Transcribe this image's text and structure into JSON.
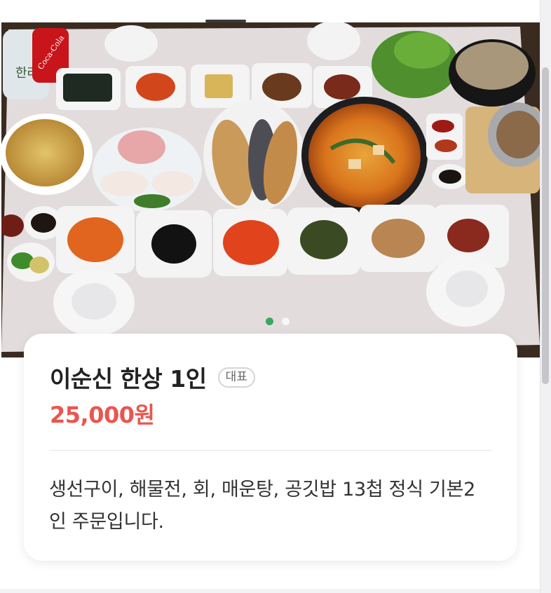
{
  "menu_item": {
    "title": "이순신 한상 1인",
    "badge": "대표",
    "price": "25,000원",
    "description": "생선구이, 해물전, 회, 매운탕, 공깃밥 13첩 정식 기본2인 주문입니다."
  },
  "carousel": {
    "slide_count": 2,
    "active_index": 0
  },
  "photo": {
    "bottle_label": "Coca-Cola",
    "jar_label": "한라산"
  },
  "colors": {
    "price": "#e8574f",
    "dot_active": "#3aa860"
  }
}
